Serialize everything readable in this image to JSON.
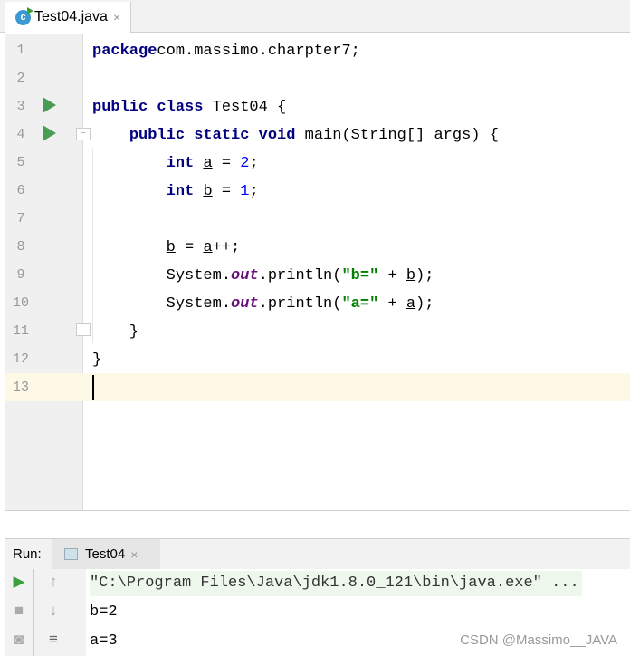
{
  "editor_tab": {
    "filename": "Test04.java",
    "close": "×"
  },
  "code_lines": [
    {
      "n": "1",
      "tokens": [
        [
          "kw",
          "package"
        ],
        [
          "",
          "com.massimo.charpter7;"
        ]
      ]
    },
    {
      "n": "2",
      "tokens": []
    },
    {
      "n": "3",
      "tokens": [
        [
          "kw",
          "public class"
        ],
        [
          "",
          " Test04 "
        ],
        [
          "br",
          "{"
        ]
      ]
    },
    {
      "n": "4",
      "tokens": [
        [
          "",
          "    "
        ],
        [
          "kw",
          "public static void"
        ],
        [
          "",
          " main(String[] args) {"
        ]
      ]
    },
    {
      "n": "5",
      "tokens": [
        [
          "",
          "        "
        ],
        [
          "kw",
          "int"
        ],
        [
          "",
          " "
        ],
        [
          "var",
          "a"
        ],
        [
          "",
          " = "
        ],
        [
          "num",
          "2"
        ],
        [
          "",
          ";"
        ]
      ]
    },
    {
      "n": "6",
      "tokens": [
        [
          "",
          "        "
        ],
        [
          "kw",
          "int"
        ],
        [
          "",
          " "
        ],
        [
          "var",
          "b"
        ],
        [
          "",
          " = "
        ],
        [
          "num",
          "1"
        ],
        [
          "",
          ";"
        ]
      ]
    },
    {
      "n": "7",
      "tokens": []
    },
    {
      "n": "8",
      "tokens": [
        [
          "",
          "        "
        ],
        [
          "var",
          "b"
        ],
        [
          "",
          " = "
        ],
        [
          "var",
          "a"
        ],
        [
          "",
          "++;"
        ]
      ]
    },
    {
      "n": "9",
      "tokens": [
        [
          "",
          "        System."
        ],
        [
          "fld",
          "out"
        ],
        [
          "",
          ".println("
        ],
        [
          "str",
          "\"b=\""
        ],
        [
          "",
          " + "
        ],
        [
          "var",
          "b"
        ],
        [
          "",
          ");"
        ]
      ]
    },
    {
      "n": "10",
      "tokens": [
        [
          "",
          "        System."
        ],
        [
          "fld",
          "out"
        ],
        [
          "",
          ".println("
        ],
        [
          "str",
          "\"a=\""
        ],
        [
          "",
          " + "
        ],
        [
          "var",
          "a"
        ],
        [
          "",
          ");"
        ]
      ]
    },
    {
      "n": "11",
      "tokens": [
        [
          "",
          "    }"
        ]
      ]
    },
    {
      "n": "12",
      "tokens": [
        [
          "br",
          "}"
        ]
      ]
    },
    {
      "n": "13",
      "tokens": []
    }
  ],
  "run": {
    "label": "Run:",
    "tab": "Test04",
    "close": "×"
  },
  "console": [
    "\"C:\\Program Files\\Java\\jdk1.8.0_121\\bin\\java.exe\" ...",
    "b=2",
    "a=3"
  ],
  "watermark": "CSDN @Massimo__JAVA",
  "colors": {
    "keyword": "#000080",
    "number": "#0000ff",
    "string": "#008000",
    "field": "#660e7a",
    "run": "#499c54",
    "current_line": "#fdf9e6"
  }
}
